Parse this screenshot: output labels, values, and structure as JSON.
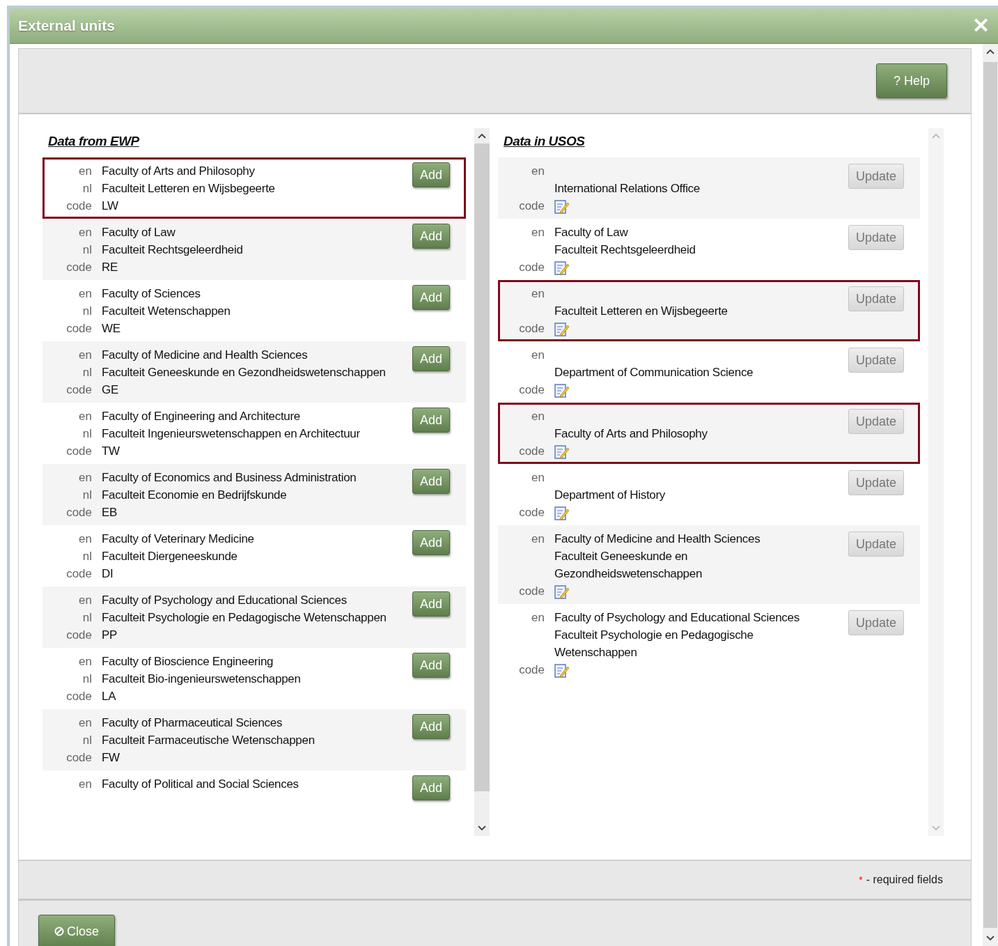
{
  "window": {
    "title": "External units",
    "close_glyph": "✕"
  },
  "toolbar": {
    "help_button": "? Help"
  },
  "ewp": {
    "heading": "Data from EWP",
    "items": [
      {
        "en_label": "en",
        "en": "Faculty of Arts and Philosophy",
        "nl_label": "nl",
        "nl": "Faculteit Letteren en Wijsbegeerte",
        "code_label": "code",
        "code": "LW",
        "button": "Add",
        "highlighted": true
      },
      {
        "en_label": "en",
        "en": "Faculty of Law",
        "nl_label": "nl",
        "nl": "Faculteit Rechtsgeleerdheid",
        "code_label": "code",
        "code": "RE",
        "button": "Add",
        "highlighted": false
      },
      {
        "en_label": "en",
        "en": "Faculty of Sciences",
        "nl_label": "nl",
        "nl": "Faculteit Wetenschappen",
        "code_label": "code",
        "code": "WE",
        "button": "Add",
        "highlighted": false
      },
      {
        "en_label": "en",
        "en": "Faculty of Medicine and Health Sciences",
        "nl_label": "nl",
        "nl": "Faculteit Geneeskunde en Gezondheidswetenschappen",
        "code_label": "code",
        "code": "GE",
        "button": "Add",
        "highlighted": false
      },
      {
        "en_label": "en",
        "en": "Faculty of Engineering and Architecture",
        "nl_label": "nl",
        "nl": "Faculteit Ingenieurswetenschappen en Architectuur",
        "code_label": "code",
        "code": "TW",
        "button": "Add",
        "highlighted": false
      },
      {
        "en_label": "en",
        "en": "Faculty of Economics and Business Administration",
        "nl_label": "nl",
        "nl": "Faculteit Economie en Bedrijfskunde",
        "code_label": "code",
        "code": "EB",
        "button": "Add",
        "highlighted": false
      },
      {
        "en_label": "en",
        "en": "Faculty of Veterinary Medicine",
        "nl_label": "nl",
        "nl": "Faculteit Diergeneeskunde",
        "code_label": "code",
        "code": "DI",
        "button": "Add",
        "highlighted": false
      },
      {
        "en_label": "en",
        "en": "Faculty of Psychology and Educational Sciences",
        "nl_label": "nl",
        "nl": "Faculteit Psychologie en Pedagogische Wetenschappen",
        "code_label": "code",
        "code": "PP",
        "button": "Add",
        "highlighted": false
      },
      {
        "en_label": "en",
        "en": "Faculty of Bioscience Engineering",
        "nl_label": "nl",
        "nl": "Faculteit Bio-ingenieurswetenschappen",
        "code_label": "code",
        "code": "LA",
        "button": "Add",
        "highlighted": false
      },
      {
        "en_label": "en",
        "en": "Faculty of Pharmaceutical Sciences",
        "nl_label": "nl",
        "nl": "Faculteit Farmaceutische Wetenschappen",
        "code_label": "code",
        "code": "FW",
        "button": "Add",
        "highlighted": false
      },
      {
        "en_label": "en",
        "en": "Faculty of Political and Social Sciences",
        "button": "Add",
        "highlighted": false
      }
    ]
  },
  "usos": {
    "heading": "Data in USOS",
    "items": [
      {
        "en_label": "en",
        "nl": "International Relations Office",
        "code_label": "code",
        "button": "Update",
        "highlighted": false
      },
      {
        "en_label": "en",
        "en": "Faculty of Law",
        "nl": "Faculteit Rechtsgeleerdheid",
        "code_label": "code",
        "button": "Update",
        "highlighted": false
      },
      {
        "en_label": "en",
        "nl": "Faculteit Letteren en Wijsbegeerte",
        "code_label": "code",
        "button": "Update",
        "highlighted": true
      },
      {
        "en_label": "en",
        "nl": "Department of Communication Science",
        "code_label": "code",
        "button": "Update",
        "highlighted": false
      },
      {
        "en_label": "en",
        "nl": "Faculty of Arts and Philosophy",
        "code_label": "code",
        "button": "Update",
        "highlighted": true
      },
      {
        "en_label": "en",
        "nl": "Department of History",
        "code_label": "code",
        "button": "Update",
        "highlighted": false
      },
      {
        "en_label": "en",
        "en": "Faculty of Medicine and Health Sciences",
        "nl": "Faculteit Geneeskunde en Gezondheidswetenschappen",
        "code_label": "code",
        "button": "Update",
        "highlighted": false
      },
      {
        "en_label": "en",
        "en": "Faculty of Psychology and Educational Sciences",
        "nl": "Faculteit Psychologie en Pedagogische Wetenschappen",
        "code_label": "code",
        "button": "Update",
        "highlighted": false
      }
    ]
  },
  "footer": {
    "asterisk": "*",
    "required_note": "- required fields"
  },
  "close_button": "Close"
}
